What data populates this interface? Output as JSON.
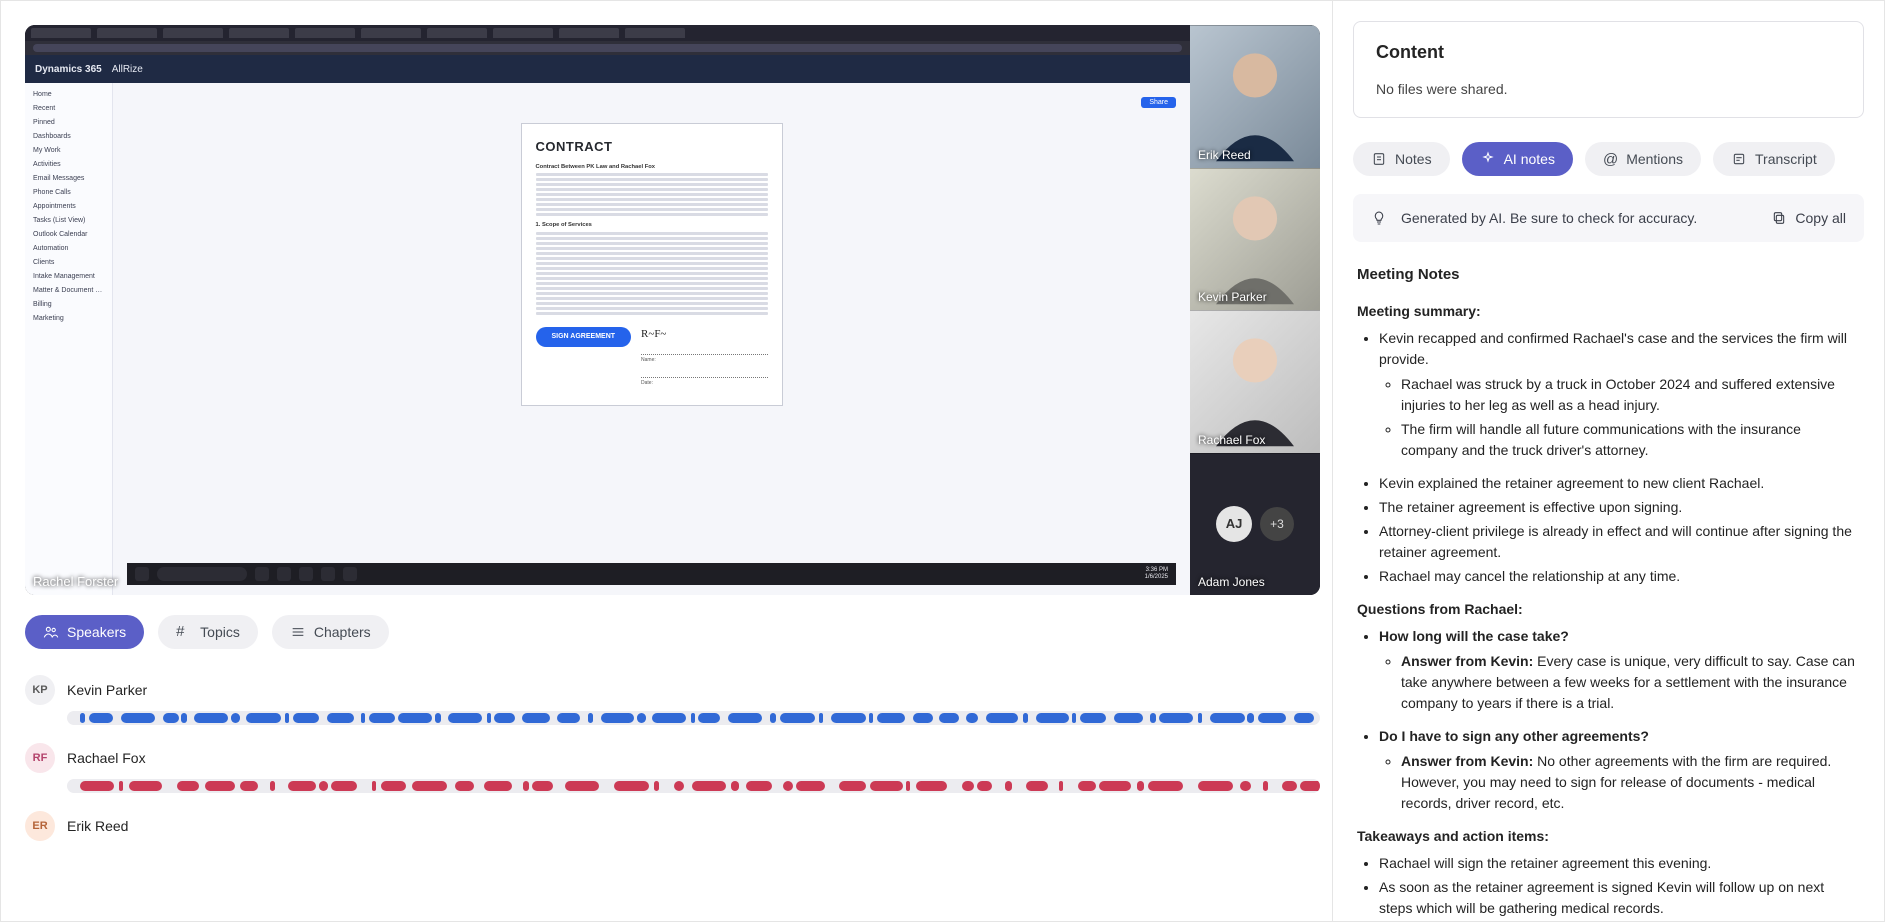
{
  "share_presenter": "Rachel Forster",
  "participants": [
    {
      "name": "Erik Reed"
    },
    {
      "name": "Kevin Parker"
    },
    {
      "name": "Rachael Fox"
    },
    {
      "name": "Adam Jones",
      "initials": "AJ",
      "extra": "+3"
    }
  ],
  "d365": {
    "brand": "Dynamics 365",
    "app": "AllRize",
    "sidebar": [
      "Home",
      "Recent",
      "Pinned",
      "Dashboards",
      "My Work",
      "Activities",
      "Email Messages",
      "Phone Calls",
      "Appointments",
      "Tasks (List View)",
      "Outlook Calendar",
      "Automation",
      "Clients",
      "Intake Management",
      "Matter & Document Management",
      "Billing",
      "Marketing"
    ],
    "share_btn": "Share",
    "contract_title": "CONTRACT",
    "contract_subtitle": "Contract Between PK Law and Rachael Fox",
    "scope_heading": "1. Scope of Services",
    "sign_btn": "SIGN AGREEMENT",
    "sig_name_label": "Name:",
    "sig_date_label": "Date:",
    "clock_time": "3:36 PM",
    "clock_date": "1/6/2025"
  },
  "pills": {
    "speakers": "Speakers",
    "topics": "Topics",
    "chapters": "Chapters"
  },
  "speakers": [
    {
      "initials": "KP",
      "name": "Kevin Parker",
      "chip": "kp",
      "color": "b"
    },
    {
      "initials": "RF",
      "name": "Rachael Fox",
      "chip": "rf",
      "color": "r"
    },
    {
      "initials": "ER",
      "name": "Erik Reed",
      "chip": "er",
      "color": ""
    }
  ],
  "right": {
    "content_h": "Content",
    "content_sub": "No files were shared.",
    "tabs": {
      "notes": "Notes",
      "ai": "AI notes",
      "mentions": "Mentions",
      "transcript": "Transcript"
    },
    "ai_banner": "Generated by AI. Be sure to check for accuracy.",
    "copy": "Copy all",
    "notes_h": "Meeting Notes",
    "summary_h": "Meeting summary:",
    "summary": [
      {
        "t": "Kevin recapped and confirmed Rachael's case and the services the firm will provide.",
        "sub": [
          "Rachael was struck by a truck in October 2024 and suffered extensive injuries to her leg as well as a head injury.",
          "The firm will handle all future communications with the insurance company and the truck driver's attorney."
        ]
      },
      {
        "t": "Kevin explained the retainer agreement to new client Rachael."
      },
      {
        "t": "The retainer agreement is effective upon signing."
      },
      {
        "t": "Attorney-client privilege is already in effect and will continue after signing the retainer agreement."
      },
      {
        "t": "Rachael may cancel the relationship at any time."
      }
    ],
    "questions_h": "Questions from Rachael:",
    "q1": "How long will the case take?",
    "q1_label": "Answer from Kevin: ",
    "q1_ans": "Every case is unique, very difficult to say. Case can take anywhere between a few weeks for a settlement with the insurance company to years if there is a trial.",
    "q2": "Do I have to sign any other agreements?",
    "q2_label": "Answer from Kevin: ",
    "q2_ans": "No other agreements with the firm are required. However, you may need to sign for release of documents - medical records, driver record, etc.",
    "takeaways_h": "Takeaways and action items:",
    "takeaways": [
      "Rachael will sign the retainer agreement this evening.",
      "As soon as the retainer agreement is signed Kevin will follow up on next steps which will be gathering medical records."
    ]
  }
}
